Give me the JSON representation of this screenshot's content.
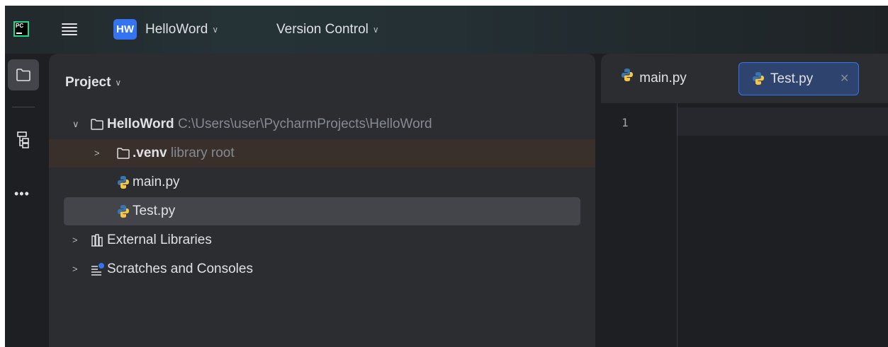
{
  "titlebar": {
    "app_logo_text": "PC",
    "project_badge": "HW",
    "project_name": "HelloWord",
    "vcs_label": "Version Control"
  },
  "toolstrip": {
    "items": [
      "folder-icon",
      "structure-icon",
      "more-icon"
    ],
    "more_label": "•••"
  },
  "project_panel": {
    "title": "Project",
    "tree": {
      "root": {
        "name": "HelloWord",
        "path": "C:\\Users\\user\\PycharmProjects\\HelloWord"
      },
      "venv": {
        "name": ".venv",
        "hint": "library root"
      },
      "files": [
        "main.py",
        "Test.py"
      ],
      "external": "External Libraries",
      "scratches": "Scratches and Consoles"
    }
  },
  "editor": {
    "tabs": [
      {
        "label": "main.py",
        "active": false
      },
      {
        "label": "Test.py",
        "active": true
      }
    ],
    "line_numbers": [
      "1"
    ]
  },
  "colors": {
    "accent": "#3574f0",
    "python_blue": "#3a75b0",
    "python_yellow": "#f7c744",
    "venv_row": "#392f2b",
    "selected_row": "#43454a"
  }
}
